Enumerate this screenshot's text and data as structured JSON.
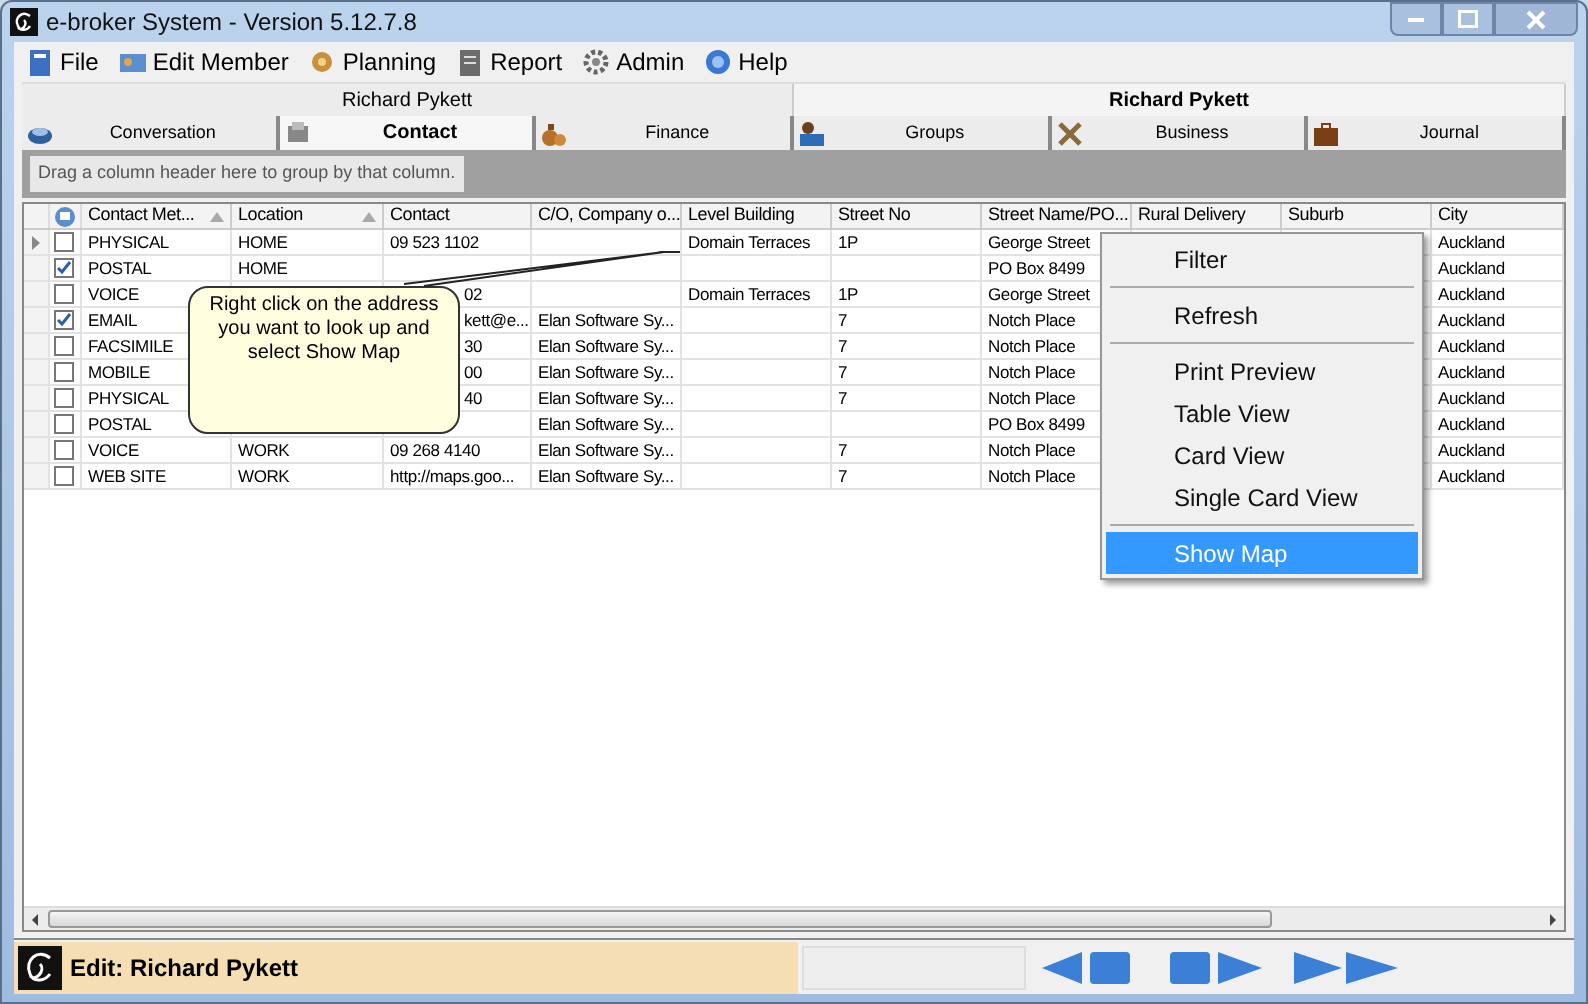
{
  "window": {
    "title": "e-broker System - Version 5.12.7.8"
  },
  "menu": [
    {
      "label": "File",
      "kind": "file"
    },
    {
      "label": "Edit Member",
      "kind": "member"
    },
    {
      "label": "Planning",
      "kind": "planning"
    },
    {
      "label": "Report",
      "kind": "report"
    },
    {
      "label": "Admin",
      "kind": "admin"
    },
    {
      "label": "Help",
      "kind": "help"
    }
  ],
  "member_headers": [
    {
      "label": "Richard Pykett",
      "selected": false
    },
    {
      "label": "Richard Pykett",
      "selected": true
    }
  ],
  "tabs": [
    {
      "label": "Conversation",
      "selected": false,
      "kind": "conversation"
    },
    {
      "label": "Contact",
      "selected": true,
      "kind": "contact"
    },
    {
      "label": "Finance",
      "selected": false,
      "kind": "finance"
    },
    {
      "label": "Groups",
      "selected": false,
      "kind": "groups"
    },
    {
      "label": "Business",
      "selected": false,
      "kind": "business"
    },
    {
      "label": "Journal",
      "selected": false,
      "kind": "journal"
    }
  ],
  "group_panel": {
    "hint": "Drag a column header here to group by that column."
  },
  "table": {
    "columns": [
      {
        "label": "Contact Met...",
        "sorted": true
      },
      {
        "label": "Location",
        "sorted": true
      },
      {
        "label": "Contact",
        "sorted": false
      },
      {
        "label": "C/O, Company o...",
        "sorted": false
      },
      {
        "label": "Level Building",
        "sorted": false
      },
      {
        "label": "Street No",
        "sorted": false
      },
      {
        "label": "Street Name/PO...",
        "sorted": false
      },
      {
        "label": "Rural Delivery",
        "sorted": false
      },
      {
        "label": "Suburb",
        "sorted": false
      },
      {
        "label": "City",
        "sorted": false
      }
    ],
    "rows": [
      {
        "current": true,
        "checked": false,
        "cells": [
          "PHYSICAL",
          "HOME",
          "09 523 1102",
          null,
          "Domain Terraces",
          "1P",
          "George Street",
          null,
          null,
          "Auckland"
        ]
      },
      {
        "current": false,
        "checked": true,
        "cells": [
          "POSTAL",
          "HOME",
          null,
          null,
          null,
          null,
          "PO Box 8499",
          null,
          null,
          "Auckland"
        ]
      },
      {
        "current": false,
        "checked": false,
        "cells": [
          "VOICE",
          null,
          "02",
          null,
          "Domain Terraces",
          "1P",
          "George Street",
          null,
          null,
          "Auckland"
        ]
      },
      {
        "current": false,
        "checked": true,
        "cells": [
          "EMAIL",
          null,
          "kett@e...",
          "Elan Software Sy...",
          null,
          "7",
          "Notch Place",
          null,
          null,
          "Auckland"
        ]
      },
      {
        "current": false,
        "checked": false,
        "cells": [
          "FACSIMILE",
          null,
          "30",
          "Elan Software Sy...",
          null,
          "7",
          "Notch Place",
          null,
          null,
          "Auckland"
        ]
      },
      {
        "current": false,
        "checked": false,
        "cells": [
          "MOBILE",
          null,
          "00",
          "Elan Software Sy...",
          null,
          "7",
          "Notch Place",
          null,
          null,
          "Auckland"
        ]
      },
      {
        "current": false,
        "checked": false,
        "cells": [
          "PHYSICAL",
          null,
          "40",
          "Elan Software Sy...",
          null,
          "7",
          "Notch Place",
          null,
          null,
          "Auckland"
        ]
      },
      {
        "current": false,
        "checked": false,
        "cells": [
          "POSTAL",
          null,
          null,
          "Elan Software Sy...",
          null,
          null,
          "PO Box 8499",
          null,
          null,
          "Auckland"
        ]
      },
      {
        "current": false,
        "checked": false,
        "cells": [
          "VOICE",
          "WORK",
          "09 268 4140",
          "Elan Software Sy...",
          null,
          "7",
          "Notch Place",
          null,
          null,
          "Auckland"
        ]
      },
      {
        "current": false,
        "checked": false,
        "cells": [
          "WEB SITE",
          "WORK",
          "http://maps.goo...",
          "Elan Software Sy...",
          null,
          "7",
          "Notch Place",
          null,
          null,
          "Auckland"
        ]
      }
    ]
  },
  "callout": {
    "text": "Right click on the address you want to look up and select Show Map"
  },
  "context_menu": [
    {
      "label": "Filter",
      "selected": false,
      "divider_after": true
    },
    {
      "label": "Refresh",
      "selected": false,
      "divider_after": true
    },
    {
      "label": "Print Preview",
      "selected": false,
      "divider_after": false
    },
    {
      "label": "Table View",
      "selected": false,
      "divider_after": false
    },
    {
      "label": "Card View",
      "selected": false,
      "divider_after": false
    },
    {
      "label": "Single Card View",
      "selected": false,
      "divider_after": true
    },
    {
      "label": "Show Map",
      "selected": true,
      "divider_after": false
    }
  ],
  "status_bar": {
    "text": "Edit: Richard Pykett"
  }
}
